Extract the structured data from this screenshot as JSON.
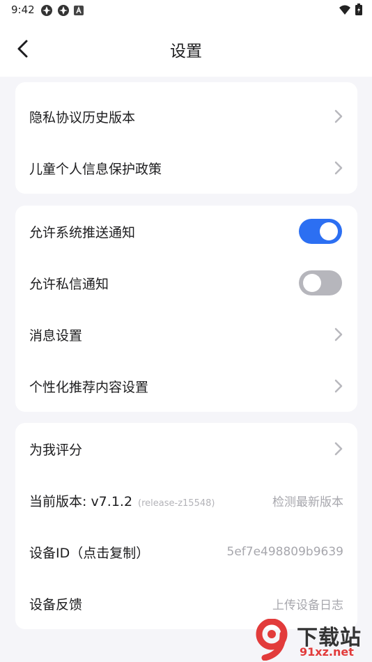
{
  "status_bar": {
    "time": "9:42"
  },
  "header": {
    "title": "设置"
  },
  "card1": [
    {
      "label": "隐私协议历史版本"
    },
    {
      "label": "儿童个人信息保护政策"
    }
  ],
  "card2": {
    "push_notify": {
      "label": "允许系统推送通知",
      "enabled": true
    },
    "dm_notify": {
      "label": "允许私信通知",
      "enabled": false
    },
    "message_settings": {
      "label": "消息设置"
    },
    "personalized": {
      "label": "个性化推荐内容设置"
    }
  },
  "card3": {
    "rate": {
      "label": "为我评分"
    },
    "version": {
      "label": "当前版本: v7.1.2",
      "build": "(release-z15548)",
      "action": "检测最新版本"
    },
    "device_id": {
      "label": "设备ID（点击复制）",
      "value": "5ef7e498809b9639"
    },
    "feedback": {
      "label": "设备反馈",
      "action": "上传设备日志"
    }
  },
  "watermark": {
    "brand": "下载站",
    "domain": "91xz.net",
    "logo_text": "9"
  },
  "colors": {
    "accent": "#2c6ff2",
    "toggle_off": "#b6b6bc",
    "background": "#f5f5f9"
  }
}
